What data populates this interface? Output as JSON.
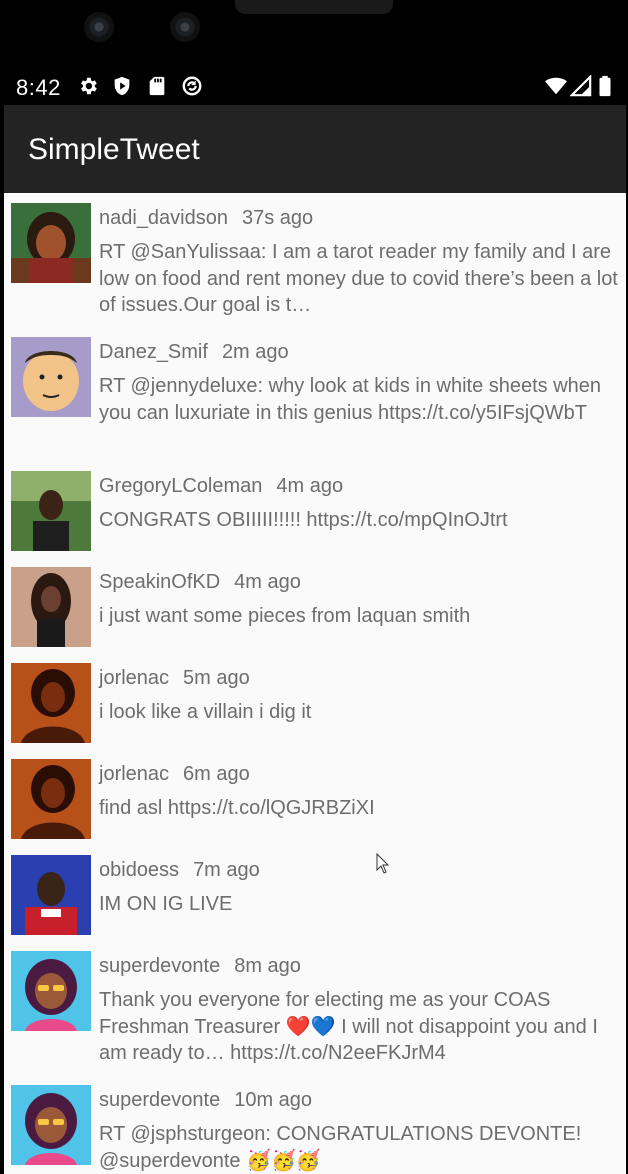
{
  "status_bar": {
    "time": "8:42",
    "icons": [
      "settings-icon",
      "shield-play-icon",
      "sd-card-icon",
      "sync-icon",
      "wifi-icon",
      "signal-icon",
      "battery-icon"
    ]
  },
  "app_bar": {
    "title": "SimpleTweet"
  },
  "colors": {
    "app_bar": "#232323",
    "background": "#fafafa",
    "text": "#6d6d6d"
  },
  "tweets": [
    {
      "user": "nadi_davidson",
      "age": "37s ago",
      "text": "RT @SanYulissaa: I am a tarot reader my family and I are low on food and rent money due to covid there’s been a lot of issues.Our goal is t…"
    },
    {
      "user": "Danez_Smif",
      "age": "2m ago",
      "text": "RT @jennydeluxe: why look at kids in white sheets when you can luxuriate in this genius https://t.co/y5IFsjQWbT"
    },
    {
      "user": "GregoryLColeman",
      "age": "4m ago",
      "text": "CONGRATS OBIIIII!!!!! https://t.co/mpQInOJtrt"
    },
    {
      "user": "SpeakinOfKD",
      "age": "4m ago",
      "text": "i just want some pieces from laquan smith"
    },
    {
      "user": "jorlenac",
      "age": "5m ago",
      "text": "i look like a villain i dig it"
    },
    {
      "user": "jorlenac",
      "age": "6m ago",
      "text": "find asl https://t.co/lQGJRBZiXI"
    },
    {
      "user": "obidoess",
      "age": "7m ago",
      "text": "IM ON IG LIVE"
    },
    {
      "user": "superdevonte",
      "age": "8m ago",
      "text": "Thank you everyone for electing me as your COAS Freshman Treasurer ❤️💙 I will not disappoint you and I am ready to… https://t.co/N2eeFKJrM4"
    },
    {
      "user": "superdevonte",
      "age": "10m ago",
      "text": "RT @jsphsturgeon: CONGRATULATIONS DEVONTE! @superdevonte 🥳🥳🥳"
    }
  ]
}
